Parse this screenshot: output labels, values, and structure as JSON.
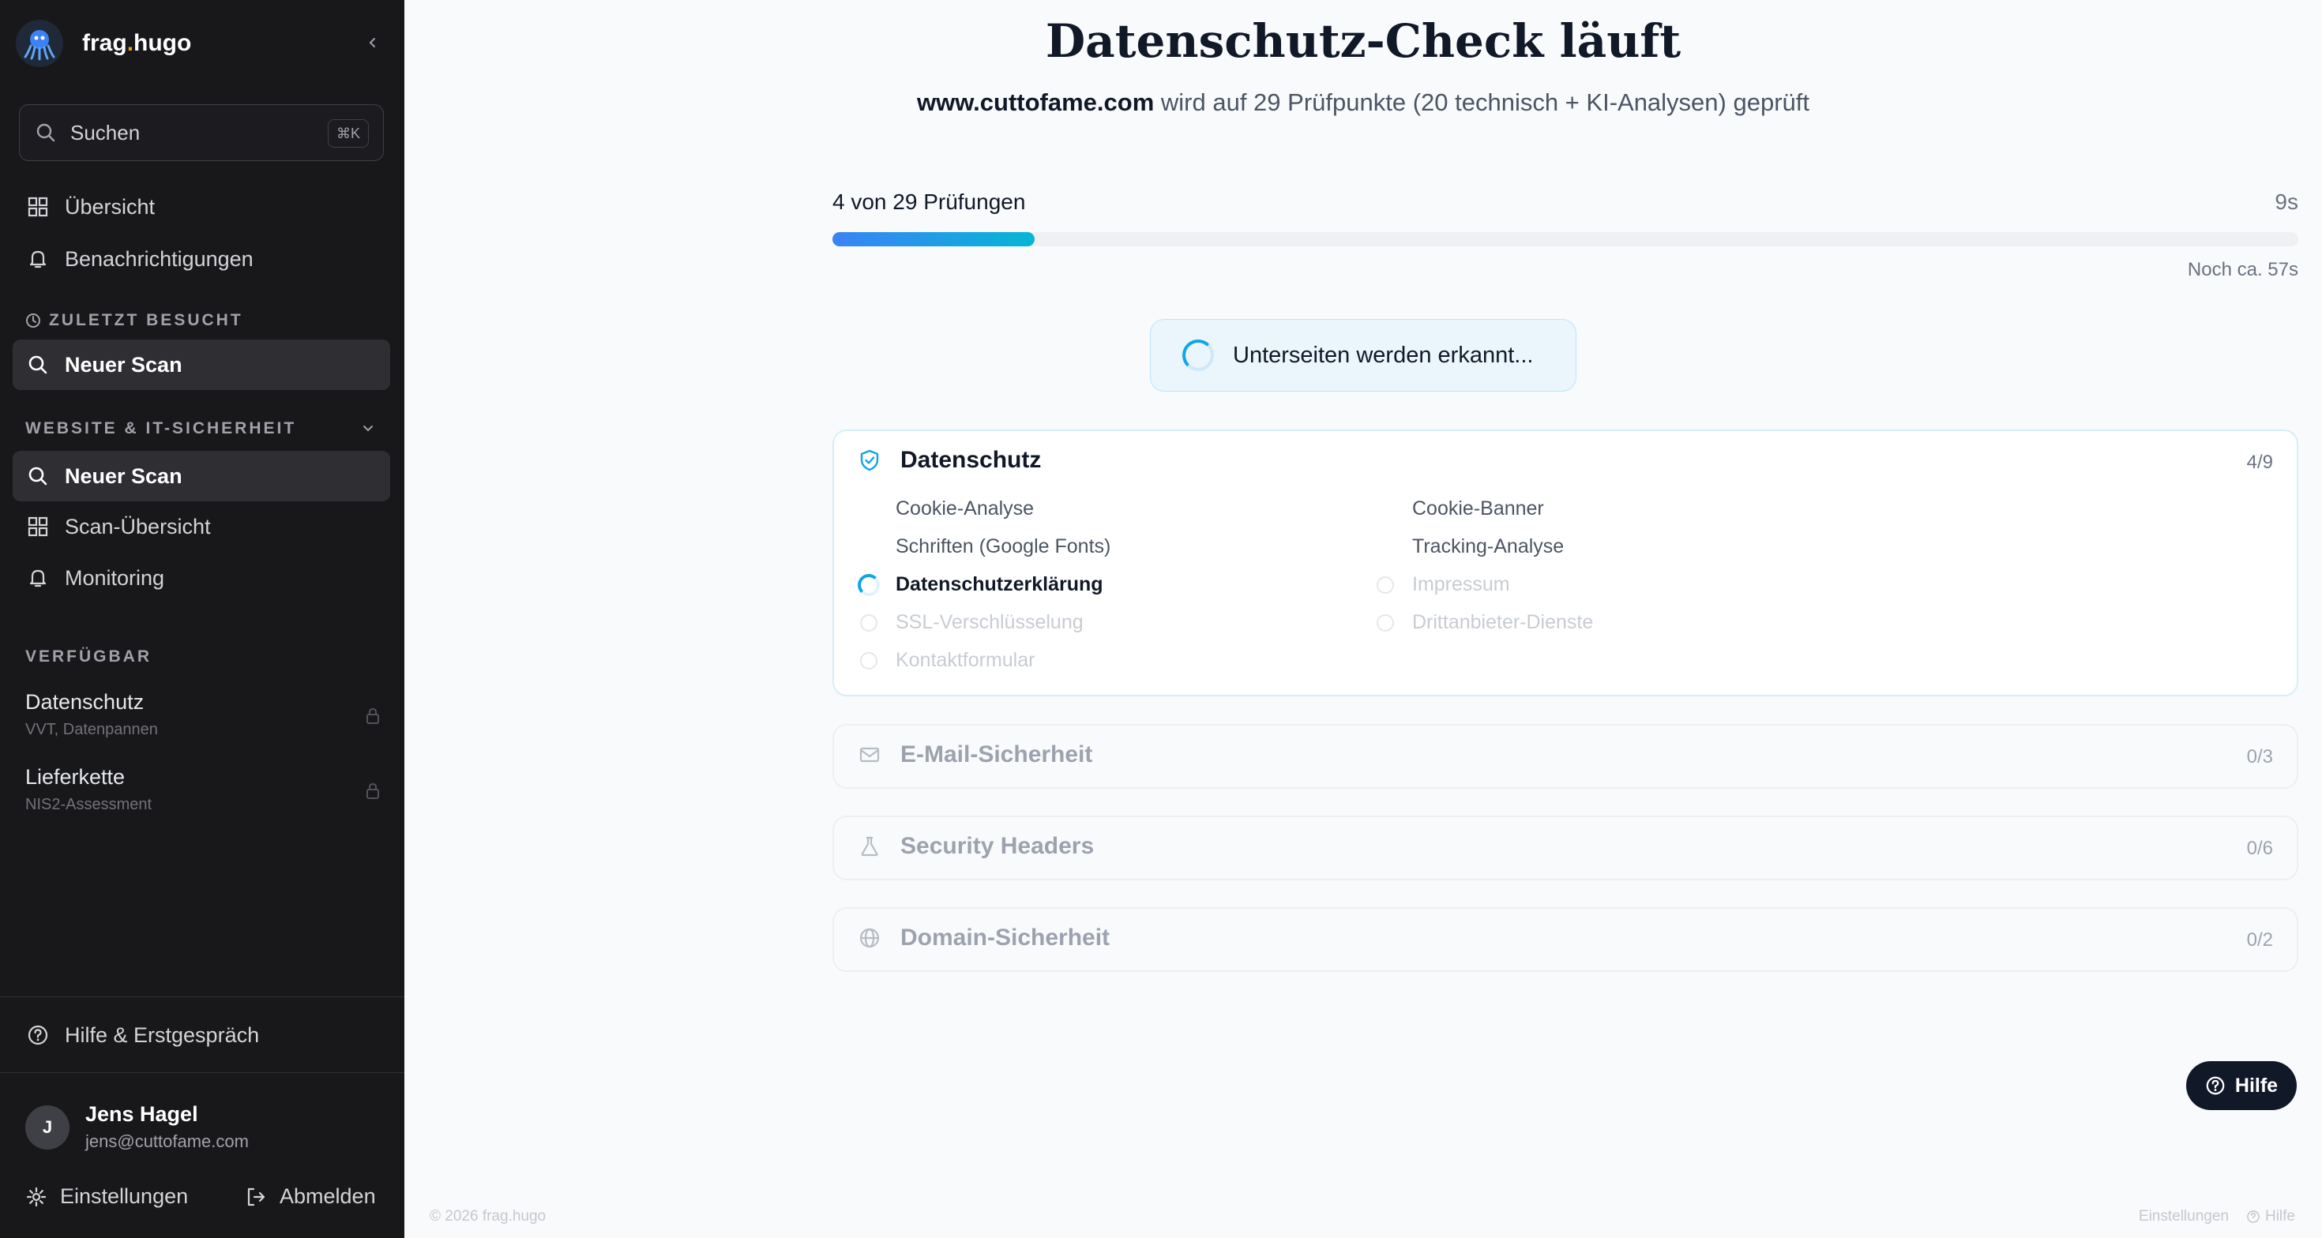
{
  "sidebar": {
    "brand": {
      "name_a": "frag",
      "dot": ".",
      "name_b": "hugo"
    },
    "search": {
      "placeholder": "Suchen",
      "shortcut": "⌘K"
    },
    "nav": [
      {
        "label": "Übersicht",
        "icon": "grid-icon"
      },
      {
        "label": "Benachrichtigungen",
        "icon": "bell-icon"
      }
    ],
    "recent": {
      "heading": "ZULETZT BESUCHT",
      "items": [
        {
          "label": "Neuer Scan",
          "icon": "search-icon"
        }
      ]
    },
    "website_security": {
      "heading": "WEBSITE & IT-SICHERHEIT",
      "items": [
        {
          "label": "Neuer Scan",
          "icon": "search-icon",
          "active": true
        },
        {
          "label": "Scan-Übersicht",
          "icon": "grid-icon"
        },
        {
          "label": "Monitoring",
          "icon": "bell-icon"
        }
      ]
    },
    "available": {
      "heading": "VERFÜGBAR",
      "items": [
        {
          "title": "Datenschutz",
          "subtitle": "VVT, Datenpannen",
          "icon": "lock-icon"
        },
        {
          "title": "Lieferkette",
          "subtitle": "NIS2-Assessment",
          "icon": "lock-icon"
        }
      ]
    },
    "help": "Hilfe & Erstgespräch",
    "user": {
      "initial": "J",
      "name": "Jens Hagel",
      "email": "jens@cuttofame.com"
    },
    "settings": "Einstellungen",
    "logout": "Abmelden"
  },
  "main": {
    "title": "Datenschutz-Check läuft",
    "subtitle": {
      "domain": "www.cuttofame.com",
      "text": " wird auf 29 Prüfpunkte (20 technisch + KI-Analysen) geprüft"
    },
    "progress": {
      "label": "4 von 29 Prüfungen",
      "elapsed": "9s",
      "remaining": "Noch ca. 57s",
      "fraction": 0.138
    },
    "status": "Unterseiten werden erkannt...",
    "sections": [
      {
        "name": "Datenschutz",
        "count": "4/9",
        "icon": "shield-check-icon",
        "items": [
          {
            "label": "Cookie-Analyse",
            "state": "done"
          },
          {
            "label": "Cookie-Banner",
            "state": "done"
          },
          {
            "label": "Schriften (Google Fonts)",
            "state": "done"
          },
          {
            "label": "Tracking-Analyse",
            "state": "done"
          },
          {
            "label": "Datenschutzerklärung",
            "state": "running"
          },
          {
            "label": "Impressum",
            "state": "pending"
          },
          {
            "label": "SSL-Verschlüsselung",
            "state": "pending"
          },
          {
            "label": "Drittanbieter-Dienste",
            "state": "pending"
          },
          {
            "label": "Kontaktformular",
            "state": "pending"
          }
        ]
      },
      {
        "name": "E-Mail-Sicherheit",
        "count": "0/3",
        "icon": "mail-icon"
      },
      {
        "name": "Security Headers",
        "count": "0/6",
        "icon": "flask-icon"
      },
      {
        "name": "Domain-Sicherheit",
        "count": "0/2",
        "icon": "globe-icon"
      }
    ]
  },
  "help_button": "Hilfe",
  "footer": {
    "copyright": "© 2026 frag.hugo",
    "settings": "Einstellungen",
    "help": "Hilfe"
  },
  "colors": {
    "sidebar_bg": "#18181b",
    "accent": "#0ea5e9",
    "progress_start": "#3b82f6",
    "progress_end": "#06b6d4"
  }
}
